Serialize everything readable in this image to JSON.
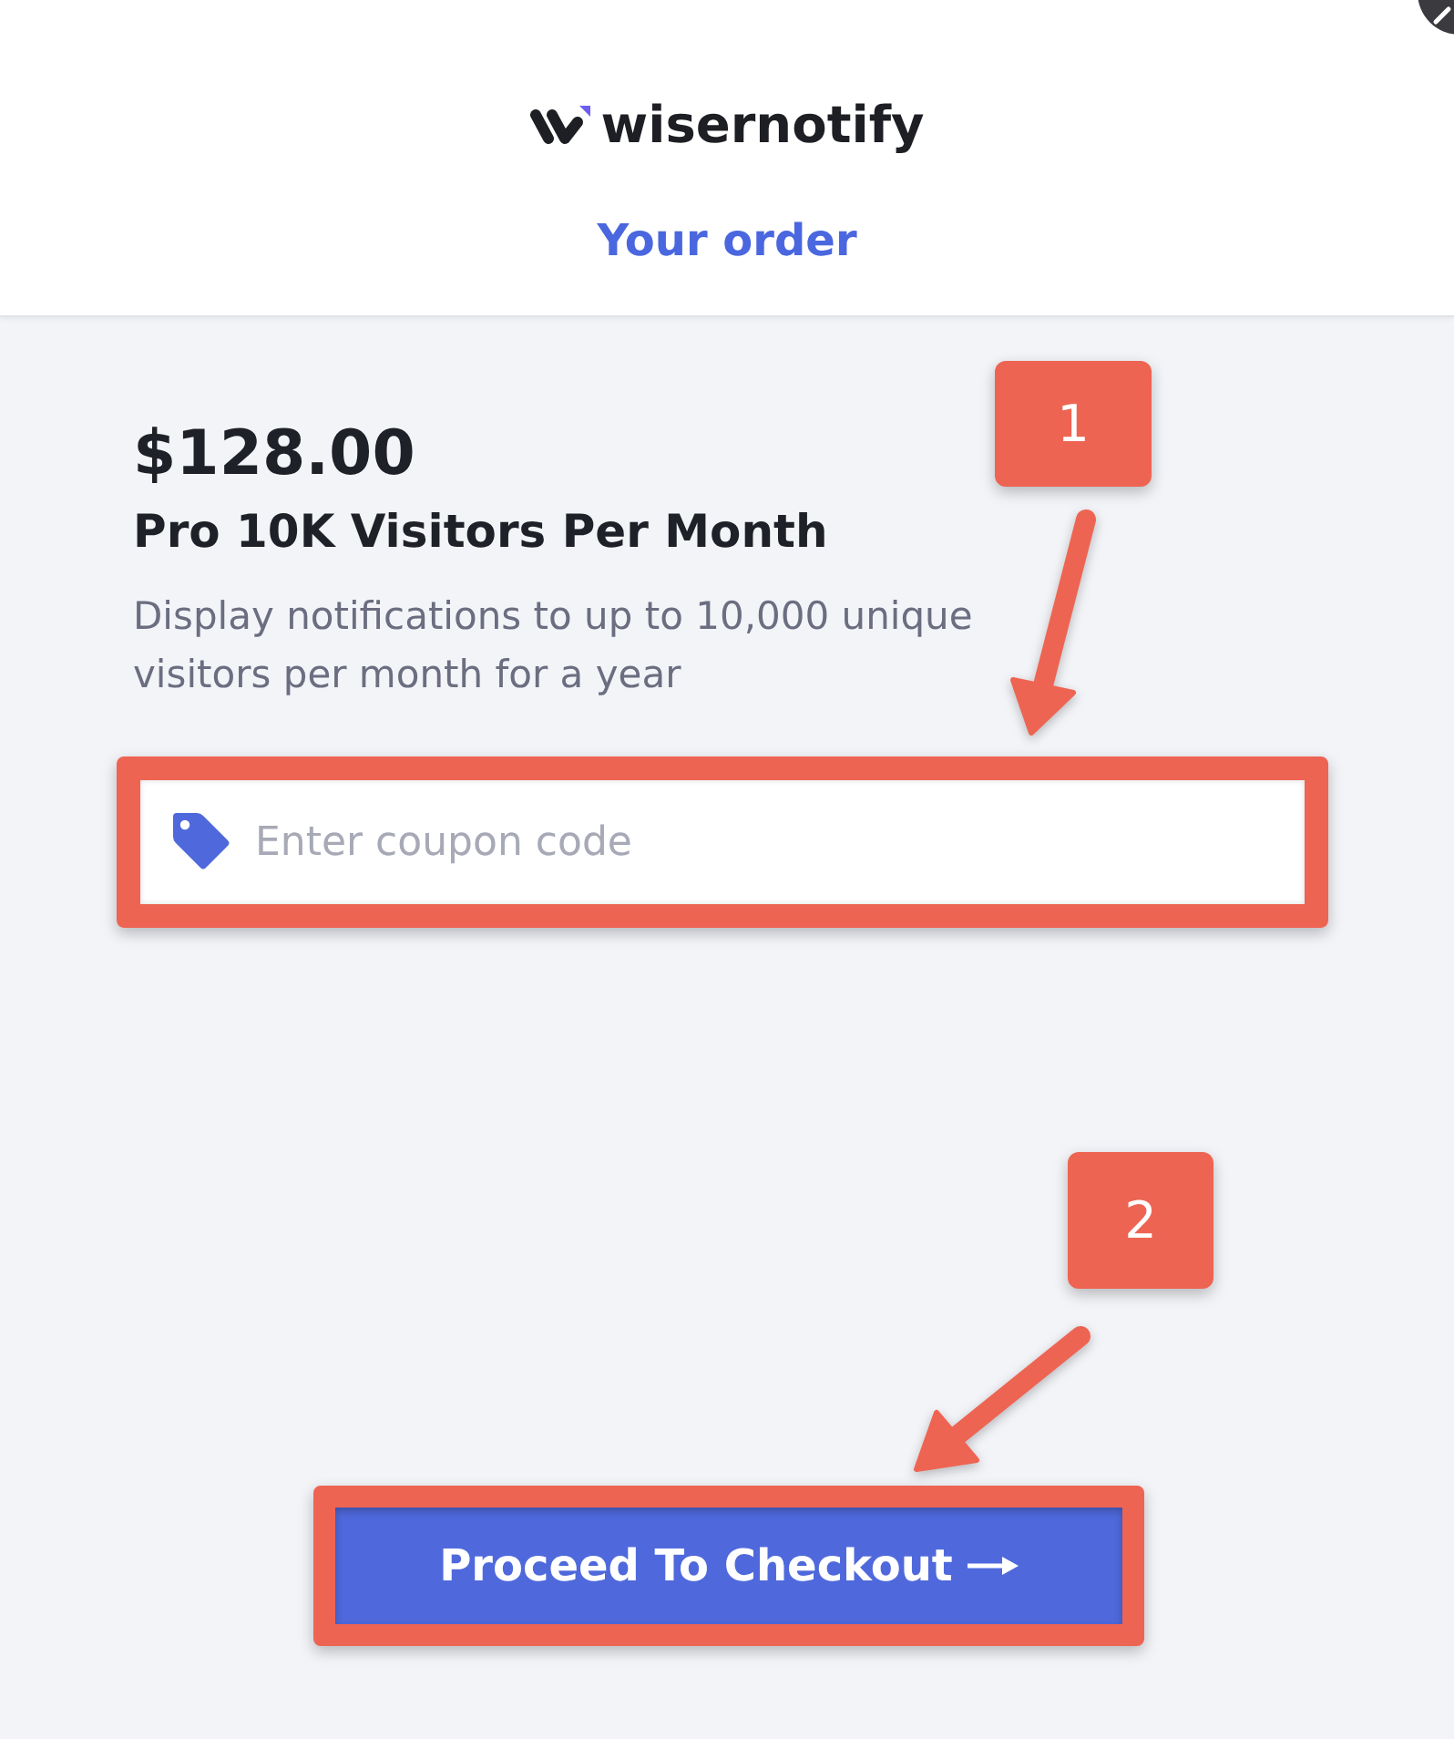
{
  "header": {
    "brand": "wisernotify",
    "title": "Your order"
  },
  "product": {
    "price": "$128.00",
    "name": "Pro 10K Visitors Per Month",
    "description": "Display notifications to up to 10,000 unique visitors per month for a year"
  },
  "coupon": {
    "placeholder": "Enter coupon code"
  },
  "checkout_button": {
    "label": "Proceed To Checkout"
  },
  "annotations": [
    {
      "label": "1"
    },
    {
      "label": "2"
    }
  ]
}
